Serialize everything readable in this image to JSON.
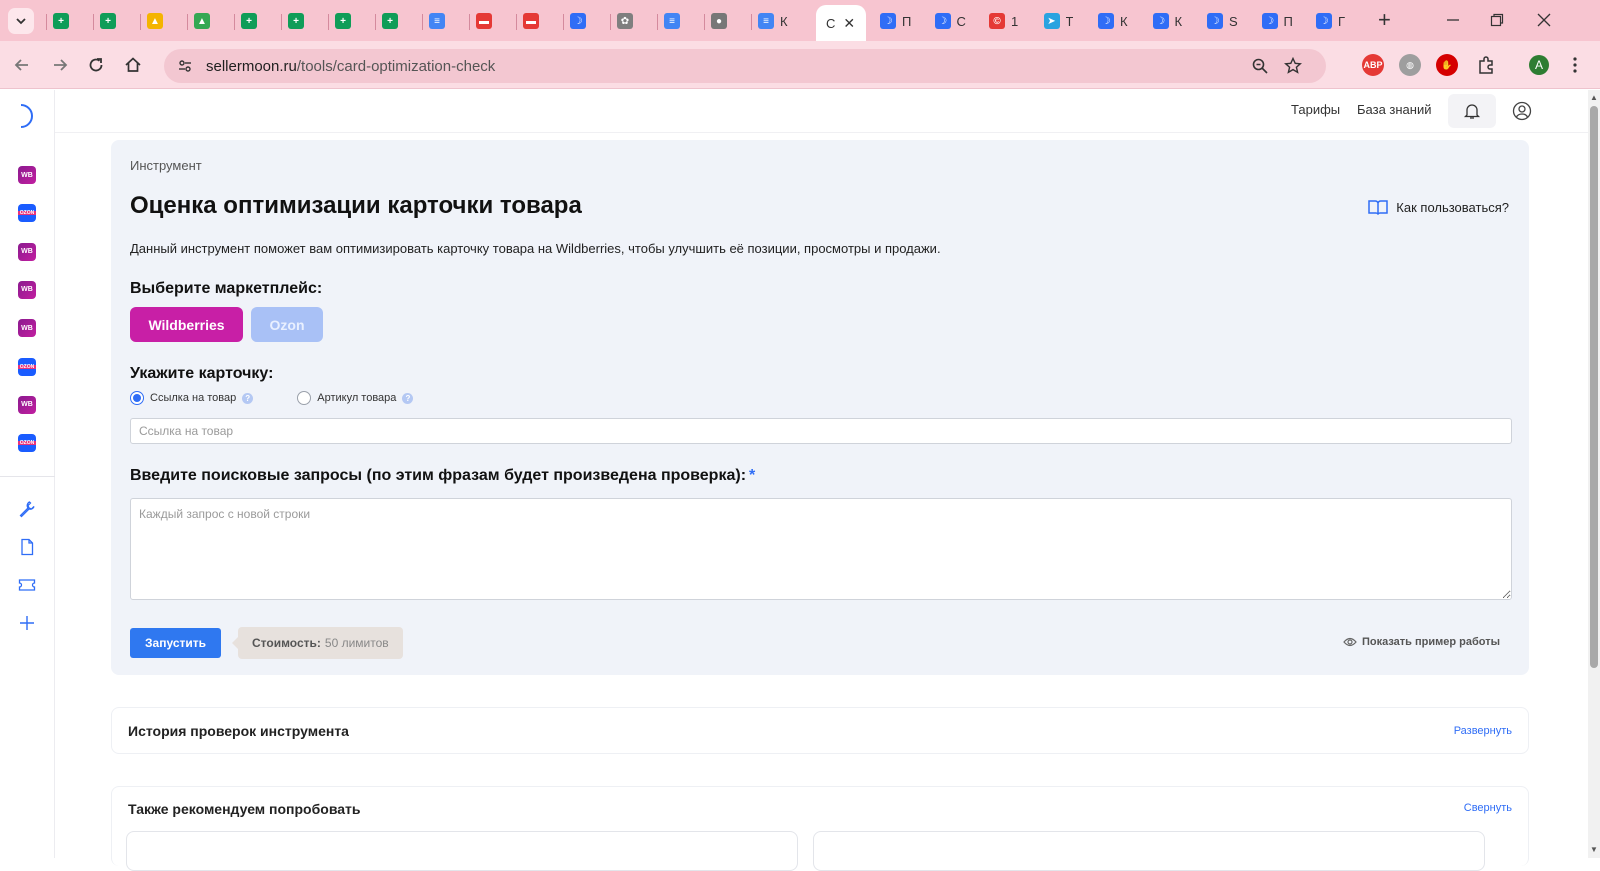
{
  "browser": {
    "tabs": [
      {
        "icon": "sheets-icon",
        "color": "#0f9d58",
        "title": "",
        "glyph": "+"
      },
      {
        "icon": "sheets-icon",
        "color": "#0f9d58",
        "title": "",
        "glyph": "+"
      },
      {
        "icon": "drive-icon",
        "color": "#f4b400",
        "title": "",
        "glyph": "▲"
      },
      {
        "icon": "drive-icon",
        "color": "#34a853",
        "title": "",
        "glyph": "▲"
      },
      {
        "icon": "sheets-icon",
        "color": "#0f9d58",
        "title": "",
        "glyph": "+"
      },
      {
        "icon": "sheets-icon",
        "color": "#0f9d58",
        "title": "",
        "glyph": "+"
      },
      {
        "icon": "sheets-icon",
        "color": "#0f9d58",
        "title": "",
        "glyph": "+"
      },
      {
        "icon": "sheets-icon",
        "color": "#0f9d58",
        "title": "",
        "glyph": "+"
      },
      {
        "icon": "docs-icon",
        "color": "#4285f4",
        "title": "",
        "glyph": "≡"
      },
      {
        "icon": "avito-icon",
        "color": "#e53935",
        "title": "",
        "glyph": "▬"
      },
      {
        "icon": "avito-icon",
        "color": "#e53935",
        "title": "",
        "glyph": "▬"
      },
      {
        "icon": "sellermoon-icon",
        "color": "#2f6df6",
        "title": "",
        "glyph": "☽"
      },
      {
        "icon": "chatgpt-icon",
        "color": "#7f7f7f",
        "title": "",
        "glyph": "✿"
      },
      {
        "icon": "docs-icon",
        "color": "#4285f4",
        "title": "",
        "glyph": "≡"
      },
      {
        "icon": "globe-icon",
        "color": "#777777",
        "title": "",
        "glyph": "●"
      },
      {
        "icon": "docs-icon",
        "color": "#4285f4",
        "title": "К",
        "glyph": "≡"
      }
    ],
    "active_tab": {
      "title": "С",
      "close": "✕"
    },
    "tabs_after": [
      {
        "icon": "sellermoon-icon",
        "color": "#2f6df6",
        "title": "П",
        "glyph": "☽"
      },
      {
        "icon": "sellermoon-icon",
        "color": "#2f6df6",
        "title": "С",
        "glyph": "☽"
      },
      {
        "icon": "copyright-icon",
        "color": "#e53935",
        "title": "1",
        "glyph": "©"
      },
      {
        "icon": "telegram-icon",
        "color": "#2aa3e0",
        "title": "Т",
        "glyph": "➤"
      },
      {
        "icon": "sellermoon-icon",
        "color": "#2f6df6",
        "title": "К",
        "glyph": "☽"
      },
      {
        "icon": "sellermoon-icon",
        "color": "#2f6df6",
        "title": "К",
        "glyph": "☽"
      },
      {
        "icon": "sellermoon-icon",
        "color": "#2f6df6",
        "title": "S",
        "glyph": "☽"
      },
      {
        "icon": "sellermoon-icon",
        "color": "#2f6df6",
        "title": "П",
        "glyph": "☽"
      },
      {
        "icon": "sellermoon-icon",
        "color": "#2f6df6",
        "title": "Г",
        "glyph": "☽"
      }
    ],
    "new_tab": "+",
    "url_host": "sellermoon.ru",
    "url_path": "/tools/card-optimization-check",
    "extensions": [
      {
        "icon": "adblock-icon",
        "color": "#e53935",
        "glyph": "ABP"
      },
      {
        "icon": "vpn-globe-icon",
        "color": "#9e9e9e",
        "glyph": "◍"
      },
      {
        "icon": "stop-hand-icon",
        "color": "#d50000",
        "glyph": "✋"
      }
    ],
    "profile_initial": "A"
  },
  "sidebar": {
    "marketplaces": [
      {
        "type": "wb",
        "label": "WB"
      },
      {
        "type": "oz",
        "label": "OZON"
      },
      {
        "type": "wb",
        "label": "WB"
      },
      {
        "type": "wb",
        "label": "WB"
      },
      {
        "type": "wb",
        "label": "WB"
      },
      {
        "type": "oz",
        "label": "OZON"
      },
      {
        "type": "wb",
        "label": "WB"
      },
      {
        "type": "oz",
        "label": "OZON"
      }
    ],
    "tools": [
      "wrench-icon",
      "document-icon",
      "ticket-icon",
      "plus-icon"
    ]
  },
  "topnav": {
    "tariffs": "Тарифы",
    "knowledge_base": "База знаний"
  },
  "tool": {
    "breadcrumb": "Инструмент",
    "title": "Оценка оптимизации карточки товара",
    "howto": "Как пользоваться?",
    "description": "Данный инструмент поможет вам оптимизировать карточку товара на Wildberries, чтобы улучшить её позиции, просмотры и продажи.",
    "marketplace_label": "Выберите маркетплейс:",
    "marketplace_wb": "Wildberries",
    "marketplace_ozon": "Ozon",
    "card_label": "Укажите карточку:",
    "radio_link": "Ссылка на товар",
    "radio_article": "Артикул товара",
    "link_placeholder": "Ссылка на товар",
    "queries_label": "Введите поисковые запросы (по этим фразам будет произведена проверка):",
    "required_mark": "*",
    "queries_placeholder": "Каждый запрос с новой строки",
    "run_button": "Запустить",
    "cost_label": "Стоимость:",
    "cost_value": "50 лимитов",
    "show_example": "Показать пример работы"
  },
  "history": {
    "title": "История проверок инструмента",
    "toggle": "Развернуть"
  },
  "recommend": {
    "title": "Также рекомендуем попробовать",
    "toggle": "Свернуть"
  }
}
